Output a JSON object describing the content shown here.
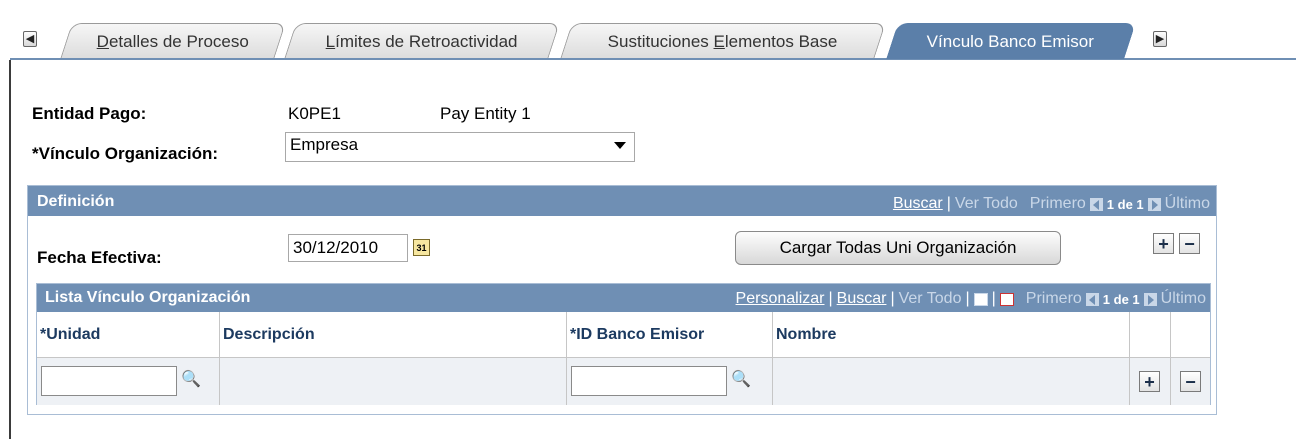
{
  "tabs": [
    {
      "pre": "",
      "u": "D",
      "post": "etalles de Proceso"
    },
    {
      "pre": "",
      "u": "L",
      "post": "ímites de Retroactividad"
    },
    {
      "pre": "Sustituciones ",
      "u": "E",
      "post": "lementos Base"
    },
    {
      "pre": "Vínculo Banco Emisor",
      "u": "",
      "post": ""
    }
  ],
  "header": {
    "entidad_label": "Entidad Pago:",
    "entidad_code": "K0PE1",
    "entidad_desc": "Pay Entity 1",
    "vinculo_label": "*Vínculo Organización:",
    "vinculo_value": "Empresa"
  },
  "definicion": {
    "title": "Definición",
    "buscar": "Buscar",
    "ver_todo": "Ver Todo",
    "primero": "Primero",
    "count": "1 de 1",
    "ultimo": "Último",
    "fecha_label": "Fecha Efectiva:",
    "fecha_value": "30/12/2010",
    "cal_icon_text": "31",
    "cargar_button": "Cargar Todas Uni Organización"
  },
  "lista": {
    "title": "Lista Vínculo Organización",
    "personalizar": "Personalizar",
    "buscar": "Buscar",
    "ver_todo": "Ver Todo",
    "primero": "Primero",
    "count": "1 de 1",
    "ultimo": "Último",
    "columns": [
      "*Unidad",
      "Descripción",
      "*ID Banco Emisor",
      "Nombre"
    ],
    "row": {
      "unidad": "",
      "descripcion": "",
      "id_banco": "",
      "nombre": ""
    }
  },
  "buttons": {
    "add": "+",
    "remove": "−"
  },
  "colors": {
    "accent": "#6f8fb4",
    "active_tab": "#5b7fa9",
    "header_text": "#1c3a60"
  }
}
